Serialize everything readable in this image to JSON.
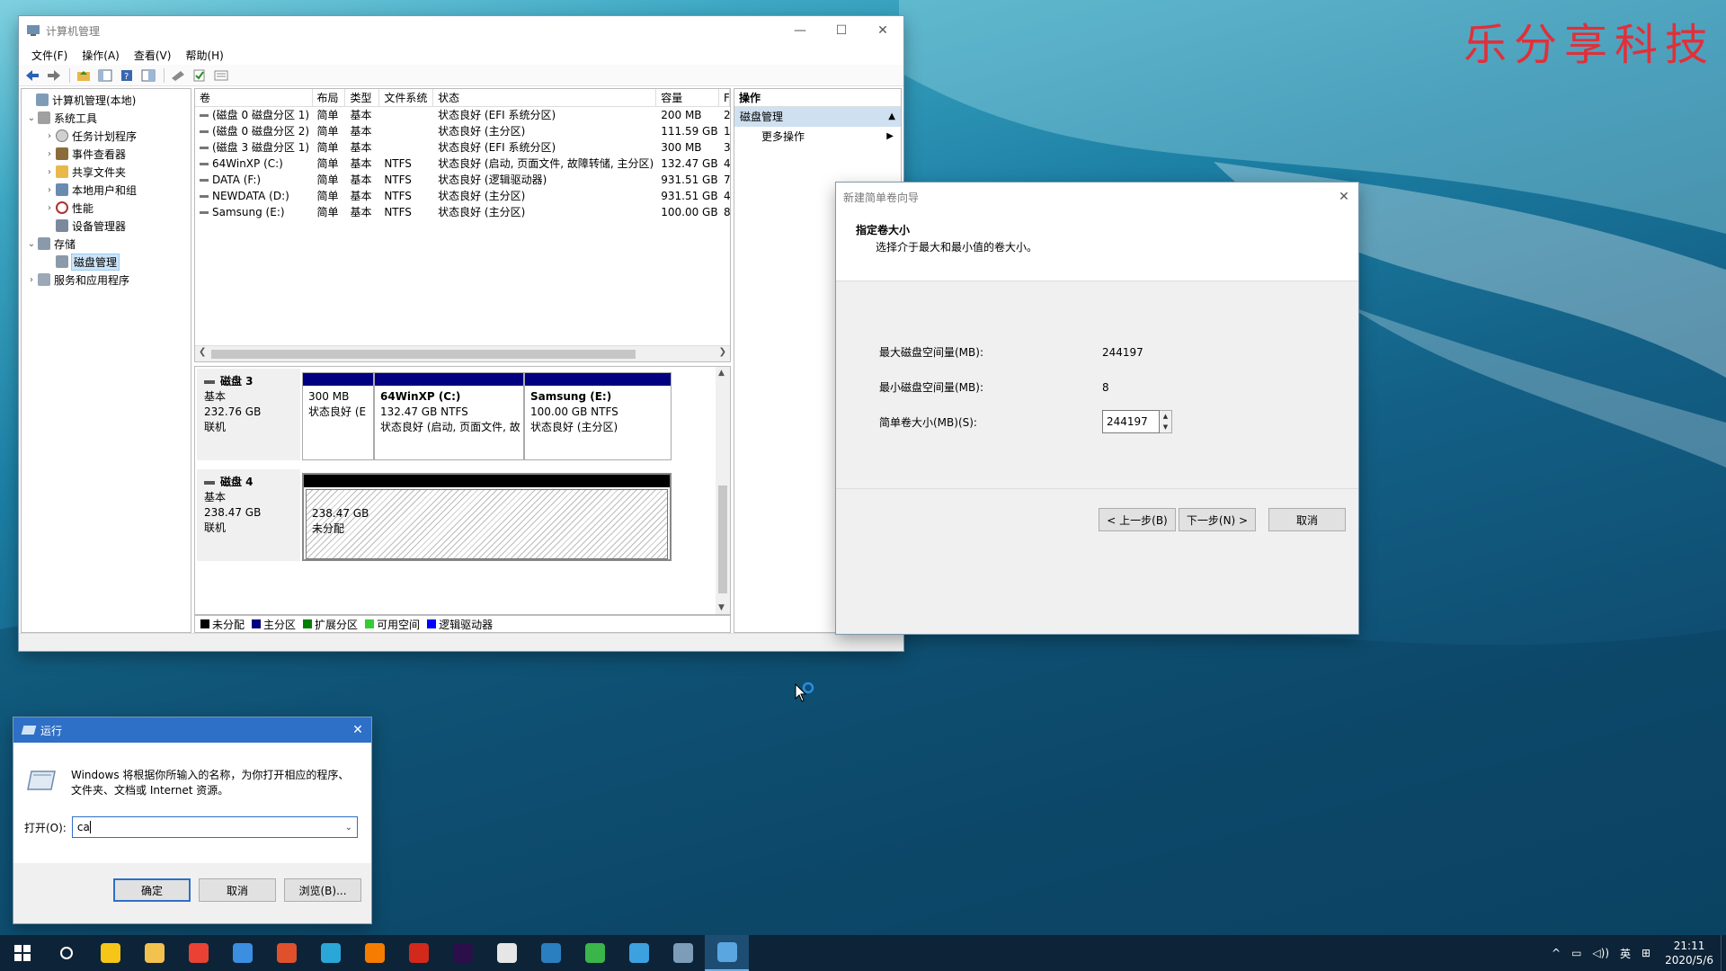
{
  "watermark": "乐分享科技",
  "mmc": {
    "title": "计算机管理",
    "menu": [
      "文件(F)",
      "操作(A)",
      "查看(V)",
      "帮助(H)"
    ],
    "tree": [
      {
        "label": "计算机管理(本地)",
        "level": 0,
        "expander": ""
      },
      {
        "label": "系统工具",
        "level": 1,
        "expander": "⌄"
      },
      {
        "label": "任务计划程序",
        "level": 2,
        "expander": "›"
      },
      {
        "label": "事件查看器",
        "level": 2,
        "expander": "›"
      },
      {
        "label": "共享文件夹",
        "level": 2,
        "expander": "›"
      },
      {
        "label": "本地用户和组",
        "level": 2,
        "expander": "›"
      },
      {
        "label": "性能",
        "level": 2,
        "expander": "›"
      },
      {
        "label": "设备管理器",
        "level": 2,
        "expander": ""
      },
      {
        "label": "存储",
        "level": 1,
        "expander": "⌄"
      },
      {
        "label": "磁盘管理",
        "level": 2,
        "expander": "",
        "selected": true
      },
      {
        "label": "服务和应用程序",
        "level": 1,
        "expander": "›"
      }
    ],
    "columns": [
      "卷",
      "布局",
      "类型",
      "文件系统",
      "状态",
      "容量",
      "F"
    ],
    "volumes": [
      [
        "(磁盘 0 磁盘分区 1)",
        "简单",
        "基本",
        "",
        "状态良好 (EFI 系统分区)",
        "200 MB",
        "2"
      ],
      [
        "(磁盘 0 磁盘分区 2)",
        "简单",
        "基本",
        "",
        "状态良好 (主分区)",
        "111.59 GB",
        "1"
      ],
      [
        "(磁盘 3 磁盘分区 1)",
        "简单",
        "基本",
        "",
        "状态良好 (EFI 系统分区)",
        "300 MB",
        "3"
      ],
      [
        "64WinXP  (C:)",
        "简单",
        "基本",
        "NTFS",
        "状态良好 (启动, 页面文件, 故障转储, 主分区)",
        "132.47 GB",
        "4"
      ],
      [
        "DATA (F:)",
        "简单",
        "基本",
        "NTFS",
        "状态良好 (逻辑驱动器)",
        "931.51 GB",
        "7"
      ],
      [
        "NEWDATA (D:)",
        "简单",
        "基本",
        "NTFS",
        "状态良好 (主分区)",
        "931.51 GB",
        "4"
      ],
      [
        "Samsung (E:)",
        "简单",
        "基本",
        "NTFS",
        "状态良好 (主分区)",
        "100.00 GB",
        "8"
      ]
    ],
    "disk3": {
      "name": "磁盘 3",
      "type": "基本",
      "size": "232.76 GB",
      "status": "联机",
      "parts": [
        {
          "name": "",
          "size": "300 MB",
          "status": "状态良好 (E"
        },
        {
          "name": "64WinXP   (C:)",
          "size": "132.47 GB NTFS",
          "status": "状态良好 (启动, 页面文件, 故"
        },
        {
          "name": "Samsung   (E:)",
          "size": "100.00 GB NTFS",
          "status": "状态良好 (主分区)"
        }
      ]
    },
    "disk4": {
      "name": "磁盘 4",
      "type": "基本",
      "size": "238.47 GB",
      "status": "联机",
      "part": {
        "size": "238.47 GB",
        "status": "未分配"
      }
    },
    "legend": [
      {
        "label": "未分配",
        "color": "#000000"
      },
      {
        "label": "主分区",
        "color": "#000080"
      },
      {
        "label": "扩展分区",
        "color": "#008000"
      },
      {
        "label": "可用空间",
        "color": "#32cd32"
      },
      {
        "label": "逻辑驱动器",
        "color": "#0000ff"
      }
    ],
    "actions": {
      "header": "操作",
      "selected": "磁盘管理",
      "more": "更多操作"
    }
  },
  "wizard": {
    "title": "新建简单卷向导",
    "heading": "指定卷大小",
    "subheading": "选择介于最大和最小值的卷大小。",
    "max_label": "最大磁盘空间量(MB):",
    "max_value": "244197",
    "min_label": "最小磁盘空间量(MB):",
    "min_value": "8",
    "size_label": "简单卷大小(MB)(S):",
    "size_value": "244197",
    "back_button": "< 上一步(B)",
    "next_button": "下一步(N) >",
    "cancel_button": "取消"
  },
  "run": {
    "title": "运行",
    "description": "Windows 将根据你所输入的名称，为你打开相应的程序、文件夹、文档或 Internet 资源。",
    "open_label": "打开(O):",
    "input_value": "ca",
    "ok_button": "确定",
    "cancel_button": "取消",
    "browse_button": "浏览(B)..."
  },
  "taskbar": {
    "apps": [
      {
        "name": "search-icon",
        "color": "transparent"
      },
      {
        "name": "note-app-icon",
        "color": "#f5c518"
      },
      {
        "name": "file-explorer-icon",
        "color": "#f2c14e"
      },
      {
        "name": "chrome-icon",
        "color": "#e94235"
      },
      {
        "name": "mail-app-icon",
        "color": "#3b8ee0"
      },
      {
        "name": "office-tiles-icon",
        "color": "#e0502c"
      },
      {
        "name": "media-player-icon",
        "color": "#2aa7d8"
      },
      {
        "name": "browser-icon",
        "color": "#f57c00"
      },
      {
        "name": "pdf-reader-icon",
        "color": "#d3291c"
      },
      {
        "name": "premiere-icon",
        "color": "#2a0f4a"
      },
      {
        "name": "music-app-icon",
        "color": "#e6e6e6"
      },
      {
        "name": "camera-app-icon",
        "color": "#2a7fbf"
      },
      {
        "name": "wechat-icon",
        "color": "#3ab54a"
      },
      {
        "name": "video-app-icon",
        "color": "#3da1e0"
      },
      {
        "name": "computer-management-icon",
        "color": "#7c9cb8"
      },
      {
        "name": "run-dialog-icon",
        "color": "#5aa6e0"
      }
    ],
    "ime": "英",
    "time": "21:11",
    "date": "2020/5/6"
  }
}
